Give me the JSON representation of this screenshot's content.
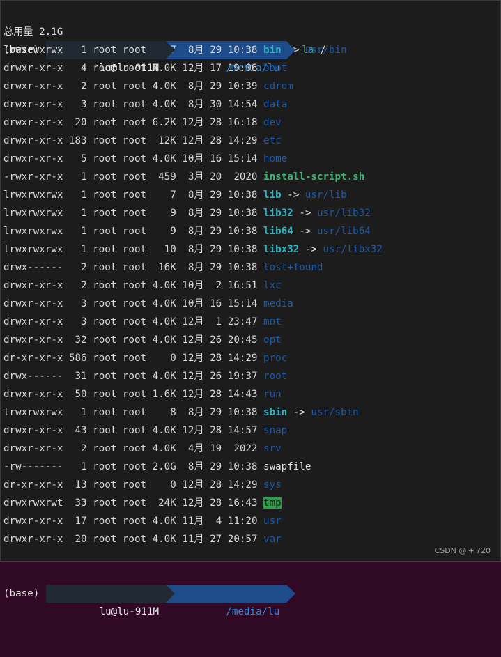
{
  "prompt_top": {
    "env": "(base)",
    "user": "lu@lu-911M",
    "path": "/media/lu",
    "command": "la",
    "arg": "/"
  },
  "total_line": "总用量 2.1G",
  "entries": [
    {
      "perm": "lrwxrwxrwx",
      "links": "1",
      "owner": "root",
      "group": "root",
      "size": "7",
      "month": "8月",
      "day": "29",
      "time": "10:38",
      "name": "bin",
      "type": "link",
      "target": "usr/bin"
    },
    {
      "perm": "drwxr-xr-x",
      "links": "4",
      "owner": "root",
      "group": "root",
      "size": "4.0K",
      "month": "12月",
      "day": "17",
      "time": "19:06",
      "name": "boot",
      "type": "dir"
    },
    {
      "perm": "drwxr-xr-x",
      "links": "2",
      "owner": "root",
      "group": "root",
      "size": "4.0K",
      "month": "8月",
      "day": "29",
      "time": "10:39",
      "name": "cdrom",
      "type": "dir"
    },
    {
      "perm": "drwxr-xr-x",
      "links": "3",
      "owner": "root",
      "group": "root",
      "size": "4.0K",
      "month": "8月",
      "day": "30",
      "time": "14:54",
      "name": "data",
      "type": "dir"
    },
    {
      "perm": "drwxr-xr-x",
      "links": "20",
      "owner": "root",
      "group": "root",
      "size": "6.2K",
      "month": "12月",
      "day": "28",
      "time": "16:18",
      "name": "dev",
      "type": "dir"
    },
    {
      "perm": "drwxr-xr-x",
      "links": "183",
      "owner": "root",
      "group": "root",
      "size": "12K",
      "month": "12月",
      "day": "28",
      "time": "14:29",
      "name": "etc",
      "type": "dir"
    },
    {
      "perm": "drwxr-xr-x",
      "links": "5",
      "owner": "root",
      "group": "root",
      "size": "4.0K",
      "month": "10月",
      "day": "16",
      "time": "15:14",
      "name": "home",
      "type": "dir"
    },
    {
      "perm": "-rwxr-xr-x",
      "links": "1",
      "owner": "root",
      "group": "root",
      "size": "459",
      "month": "3月",
      "day": "20",
      "time": "2020",
      "name": "install-script.sh",
      "type": "exec"
    },
    {
      "perm": "lrwxrwxrwx",
      "links": "1",
      "owner": "root",
      "group": "root",
      "size": "7",
      "month": "8月",
      "day": "29",
      "time": "10:38",
      "name": "lib",
      "type": "link",
      "target": "usr/lib"
    },
    {
      "perm": "lrwxrwxrwx",
      "links": "1",
      "owner": "root",
      "group": "root",
      "size": "9",
      "month": "8月",
      "day": "29",
      "time": "10:38",
      "name": "lib32",
      "type": "link",
      "target": "usr/lib32"
    },
    {
      "perm": "lrwxrwxrwx",
      "links": "1",
      "owner": "root",
      "group": "root",
      "size": "9",
      "month": "8月",
      "day": "29",
      "time": "10:38",
      "name": "lib64",
      "type": "link",
      "target": "usr/lib64"
    },
    {
      "perm": "lrwxrwxrwx",
      "links": "1",
      "owner": "root",
      "group": "root",
      "size": "10",
      "month": "8月",
      "day": "29",
      "time": "10:38",
      "name": "libx32",
      "type": "link",
      "target": "usr/libx32"
    },
    {
      "perm": "drwx------",
      "links": "2",
      "owner": "root",
      "group": "root",
      "size": "16K",
      "month": "8月",
      "day": "29",
      "time": "10:38",
      "name": "lost+found",
      "type": "dir"
    },
    {
      "perm": "drwxr-xr-x",
      "links": "2",
      "owner": "root",
      "group": "root",
      "size": "4.0K",
      "month": "10月",
      "day": "2",
      "time": "16:51",
      "name": "lxc",
      "type": "dir"
    },
    {
      "perm": "drwxr-xr-x",
      "links": "3",
      "owner": "root",
      "group": "root",
      "size": "4.0K",
      "month": "10月",
      "day": "16",
      "time": "15:14",
      "name": "media",
      "type": "dir"
    },
    {
      "perm": "drwxr-xr-x",
      "links": "3",
      "owner": "root",
      "group": "root",
      "size": "4.0K",
      "month": "12月",
      "day": "1",
      "time": "23:47",
      "name": "mnt",
      "type": "dir"
    },
    {
      "perm": "drwxr-xr-x",
      "links": "32",
      "owner": "root",
      "group": "root",
      "size": "4.0K",
      "month": "12月",
      "day": "26",
      "time": "20:45",
      "name": "opt",
      "type": "dir"
    },
    {
      "perm": "dr-xr-xr-x",
      "links": "586",
      "owner": "root",
      "group": "root",
      "size": "0",
      "month": "12月",
      "day": "28",
      "time": "14:29",
      "name": "proc",
      "type": "dir"
    },
    {
      "perm": "drwx------",
      "links": "31",
      "owner": "root",
      "group": "root",
      "size": "4.0K",
      "month": "12月",
      "day": "26",
      "time": "19:37",
      "name": "root",
      "type": "dir"
    },
    {
      "perm": "drwxr-xr-x",
      "links": "50",
      "owner": "root",
      "group": "root",
      "size": "1.6K",
      "month": "12月",
      "day": "28",
      "time": "14:43",
      "name": "run",
      "type": "dir"
    },
    {
      "perm": "lrwxrwxrwx",
      "links": "1",
      "owner": "root",
      "group": "root",
      "size": "8",
      "month": "8月",
      "day": "29",
      "time": "10:38",
      "name": "sbin",
      "type": "link",
      "target": "usr/sbin"
    },
    {
      "perm": "drwxr-xr-x",
      "links": "43",
      "owner": "root",
      "group": "root",
      "size": "4.0K",
      "month": "12月",
      "day": "28",
      "time": "14:57",
      "name": "snap",
      "type": "dir"
    },
    {
      "perm": "drwxr-xr-x",
      "links": "2",
      "owner": "root",
      "group": "root",
      "size": "4.0K",
      "month": "4月",
      "day": "19",
      "time": "2022",
      "name": "srv",
      "type": "dir"
    },
    {
      "perm": "-rw-------",
      "links": "1",
      "owner": "root",
      "group": "root",
      "size": "2.0G",
      "month": "8月",
      "day": "29",
      "time": "10:38",
      "name": "swapfile",
      "type": "plain"
    },
    {
      "perm": "dr-xr-xr-x",
      "links": "13",
      "owner": "root",
      "group": "root",
      "size": "0",
      "month": "12月",
      "day": "28",
      "time": "14:29",
      "name": "sys",
      "type": "dir"
    },
    {
      "perm": "drwxrwxrwt",
      "links": "33",
      "owner": "root",
      "group": "root",
      "size": "24K",
      "month": "12月",
      "day": "28",
      "time": "16:43",
      "name": "tmp",
      "type": "sticky"
    },
    {
      "perm": "drwxr-xr-x",
      "links": "17",
      "owner": "root",
      "group": "root",
      "size": "4.0K",
      "month": "11月",
      "day": "4",
      "time": "11:20",
      "name": "usr",
      "type": "dir"
    },
    {
      "perm": "drwxr-xr-x",
      "links": "20",
      "owner": "root",
      "group": "root",
      "size": "4.0K",
      "month": "11月",
      "day": "27",
      "time": "20:57",
      "name": "var",
      "type": "dir"
    }
  ],
  "prompt_bottom": {
    "env": "(base)",
    "user": "lu@lu-911M",
    "path": "/media/lu"
  },
  "link_arrow": "->",
  "watermark": "CSDN @ + 720",
  "colors": {
    "background": "#1c1c1c",
    "dir": "#1c5aa8",
    "link": "#2fb5c4",
    "exec": "#3cb371",
    "sticky_bg": "#2e9e4d"
  }
}
